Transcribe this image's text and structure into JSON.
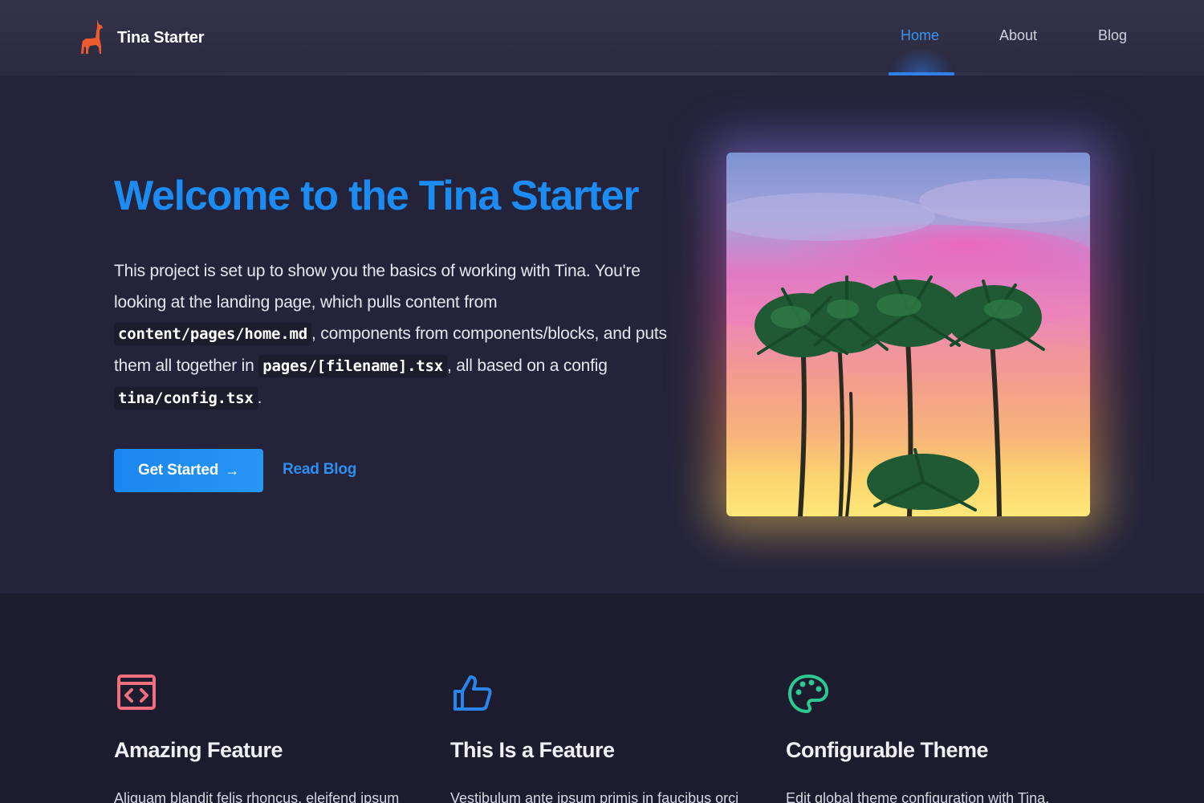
{
  "header": {
    "brand_name": "Tina Starter",
    "logo_icon": "llama-icon",
    "logo_color": "#ec5a2e",
    "nav": [
      {
        "label": "Home",
        "active": true
      },
      {
        "label": "About",
        "active": false
      },
      {
        "label": "Blog",
        "active": false
      }
    ],
    "accent_color": "#2f80e8"
  },
  "hero": {
    "title": "Welcome to the Tina Starter",
    "body_1": "This project is set up to show you the basics of working with Tina. You're looking at the landing page, which pulls content from ",
    "code_1": "content/pages/home.md",
    "body_2": ", components from components/blocks, and puts them all together in ",
    "code_2": "pages/[filename].tsx",
    "body_3": ", all based on a config ",
    "code_3": "tina/config.tsx",
    "body_4": ".",
    "primary_action": {
      "label": "Get Started",
      "icon": "arrow-right-icon"
    },
    "secondary_action": {
      "label": "Read Blog"
    },
    "image_subject": "palm-trees-sunset"
  },
  "features": [
    {
      "icon": "code-window-icon",
      "icon_color": "#f2707e",
      "title": "Amazing Feature",
      "text": "Aliquam blandit felis rhoncus, eleifend ipsum"
    },
    {
      "icon": "thumbs-up-icon",
      "icon_color": "#2a86ee",
      "title": "This Is a Feature",
      "text": "Vestibulum ante ipsum primis in faucibus orci"
    },
    {
      "icon": "palette-icon",
      "icon_color": "#2cc990",
      "title": "Configurable Theme",
      "text": "Edit global theme configuration with Tina."
    }
  ]
}
